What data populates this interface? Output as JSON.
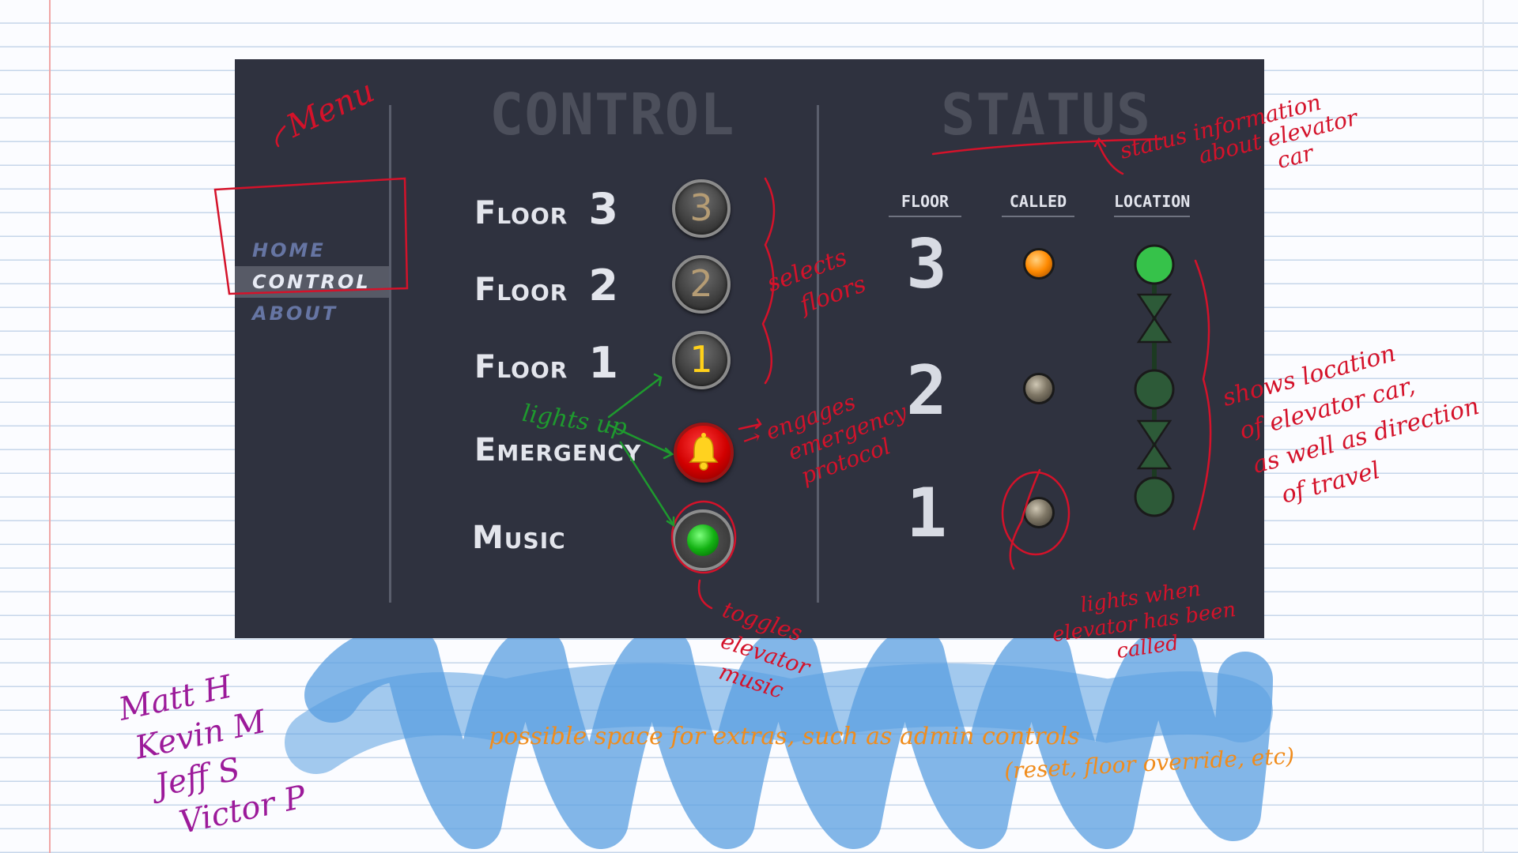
{
  "menu": {
    "items": [
      {
        "label": "HOME",
        "active": false
      },
      {
        "label": "CONTROL",
        "active": true
      },
      {
        "label": "ABOUT",
        "active": false
      }
    ]
  },
  "control": {
    "title": "CONTROL",
    "floor_word": "Floor",
    "floors": [
      {
        "number": "3",
        "lit": false
      },
      {
        "number": "2",
        "lit": false
      },
      {
        "number": "1",
        "lit": true
      }
    ],
    "emergency_label": "Emergency",
    "music_label": "Music"
  },
  "status": {
    "title": "STATUS",
    "headers": {
      "floor": "FLOOR",
      "called": "CALLED",
      "location": "LOCATION"
    },
    "rows": [
      {
        "floor": "3",
        "called": true,
        "car_here": true
      },
      {
        "floor": "2",
        "called": false,
        "car_here": false
      },
      {
        "floor": "1",
        "called": false,
        "car_here": false
      }
    ]
  },
  "annotations": {
    "menu": "Menu",
    "status_info": [
      "status information",
      "about elevator",
      "car"
    ],
    "selects_floors": [
      "selects",
      "floors"
    ],
    "lights_up": "lights up",
    "engages": [
      "→ engages",
      "emergency",
      "protocol"
    ],
    "toggles": [
      "toggles",
      "elevator",
      "music"
    ],
    "lights_when": [
      "lights when",
      "elevator has been",
      "called"
    ],
    "shows_location": [
      "shows location",
      "of elevator car,",
      "as well as direction",
      "of travel"
    ],
    "extras": "possible space for extras, such as admin controls",
    "extras_sub": "(reset, floor override, etc)",
    "names": [
      "Matt H",
      "Kevin M",
      "Jeff S",
      "Victor P"
    ]
  },
  "colors": {
    "panel": "#2f323f",
    "red_ink": "#d4122a",
    "green_ink": "#1e9a2e",
    "orange_ink": "#f08c1c",
    "purple_ink": "#9c1a9a",
    "blue_marker": "#5a9fe0",
    "location_on": "#36c24a",
    "location_off": "#2d5a38",
    "called_on": "#ff8a00"
  }
}
